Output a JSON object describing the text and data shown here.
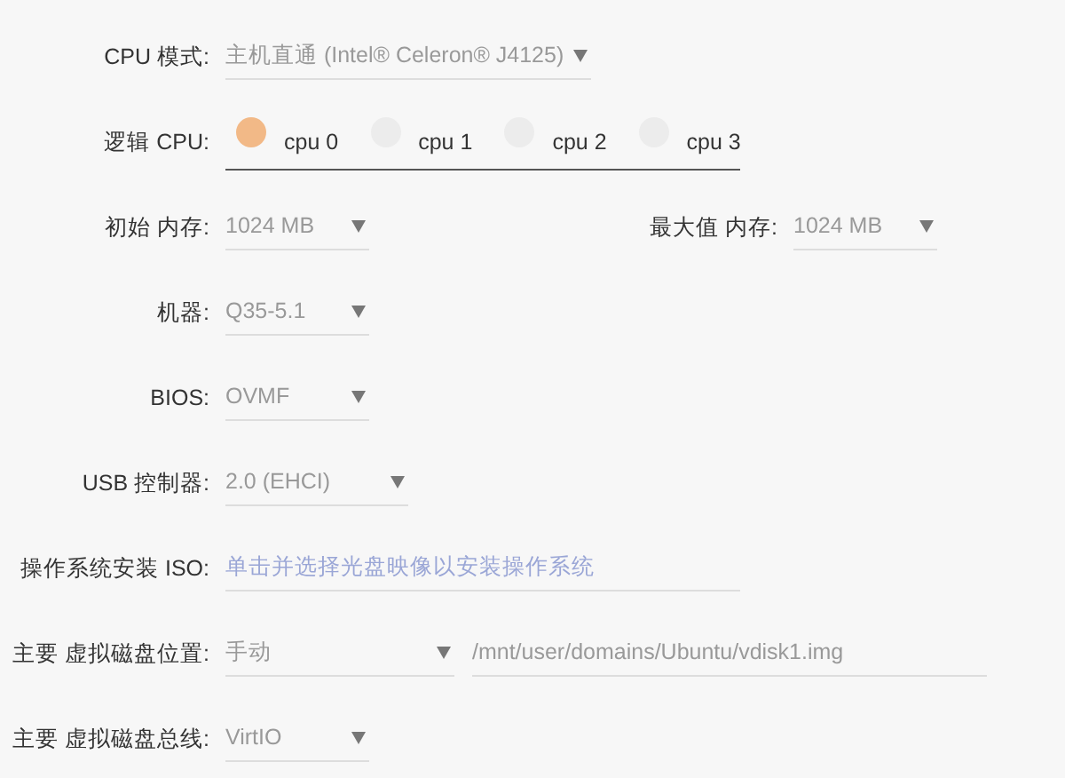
{
  "rows": [
    {
      "items": [
        {
          "kind": "label",
          "text": "CPU 模式:"
        },
        {
          "kind": "select",
          "value": "主机直通 (Intel® Celeron® J4125)"
        }
      ]
    },
    {
      "items": [
        {
          "kind": "label",
          "text": "逻辑 CPU:"
        },
        {
          "kind": "cpus",
          "options": [
            {
              "label": "cpu 0",
              "selected": true
            },
            {
              "label": "cpu 1",
              "selected": false
            },
            {
              "label": "cpu 2",
              "selected": false
            },
            {
              "label": "cpu 3",
              "selected": false
            }
          ]
        }
      ]
    },
    {
      "items": [
        {
          "kind": "label",
          "text": "初始 内存:"
        },
        {
          "kind": "select",
          "value": "1024 MB"
        },
        {
          "kind": "label",
          "text": "最大值 内存:"
        },
        {
          "kind": "select",
          "value": "1024 MB"
        }
      ]
    },
    {
      "items": [
        {
          "kind": "label",
          "text": "机器:"
        },
        {
          "kind": "select",
          "value": "Q35-5.1"
        }
      ]
    },
    {
      "items": [
        {
          "kind": "label",
          "text": "BIOS:"
        },
        {
          "kind": "select",
          "value": "OVMF"
        }
      ]
    },
    {
      "items": [
        {
          "kind": "label",
          "text": "USB 控制器:"
        },
        {
          "kind": "select",
          "value": "2.0 (EHCI)"
        }
      ]
    },
    {
      "items": [
        {
          "kind": "label",
          "text": "操作系统安装 ISO:"
        },
        {
          "kind": "file",
          "placeholder": "单击并选择光盘映像以安装操作系统"
        }
      ]
    },
    {
      "items": [
        {
          "kind": "label",
          "text": "主要 虚拟磁盘位置:"
        },
        {
          "kind": "select",
          "value": "手动"
        },
        {
          "kind": "text",
          "value": "/mnt/user/domains/Ubuntu/vdisk1.img"
        }
      ]
    },
    {
      "items": [
        {
          "kind": "label",
          "text": "主要 虚拟磁盘总线:"
        },
        {
          "kind": "select",
          "value": "VirtIO"
        }
      ]
    }
  ]
}
